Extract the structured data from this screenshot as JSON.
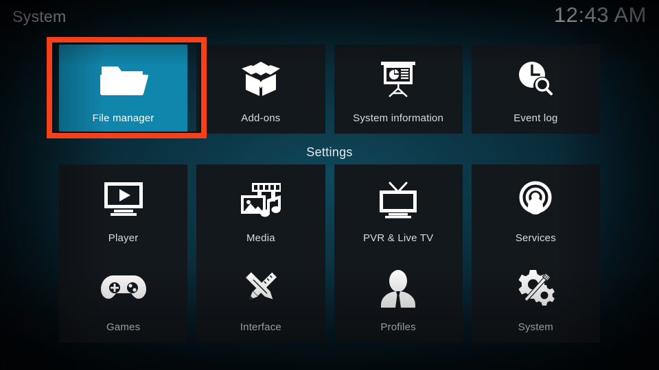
{
  "header": {
    "title": "System",
    "clock": "12:43 AM"
  },
  "section": {
    "settings_label": "Settings"
  },
  "colors": {
    "selection": "#1186ac",
    "tile_background": "#13181d",
    "annotation": "#f5401a",
    "text": "#d5dde2"
  },
  "top_row": [
    {
      "label": "File manager",
      "icon": "folder-icon",
      "selected": true
    },
    {
      "label": "Add-ons",
      "icon": "open-box-icon",
      "selected": false
    },
    {
      "label": "System information",
      "icon": "presentation-chart-icon",
      "selected": false
    },
    {
      "label": "Event log",
      "icon": "clock-search-icon",
      "selected": false
    }
  ],
  "settings_rows": [
    [
      {
        "label": "Player",
        "icon": "monitor-play-icon",
        "selected": false
      },
      {
        "label": "Media",
        "icon": "media-library-icon",
        "selected": false
      },
      {
        "label": "PVR & Live TV",
        "icon": "tv-antenna-icon",
        "selected": false
      },
      {
        "label": "Services",
        "icon": "broadcast-user-icon",
        "selected": false
      }
    ],
    [
      {
        "label": "Games",
        "icon": "gamepad-icon",
        "selected": false
      },
      {
        "label": "Interface",
        "icon": "pencil-ruler-icon",
        "selected": false
      },
      {
        "label": "Profiles",
        "icon": "user-bust-icon",
        "selected": false
      },
      {
        "label": "System",
        "icon": "gear-wrench-icon",
        "selected": false
      }
    ]
  ]
}
